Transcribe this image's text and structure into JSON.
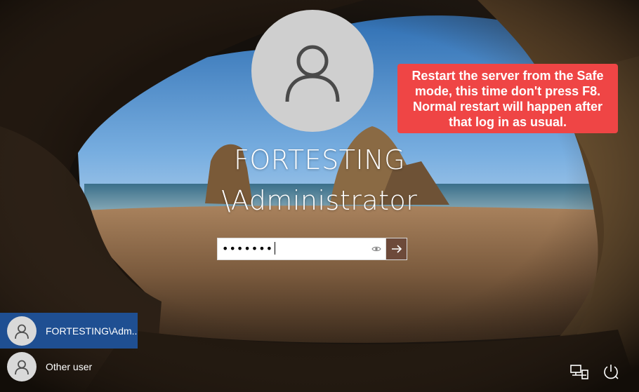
{
  "login": {
    "username_line1": "FORTESTING",
    "username_line2": "\\Administrator",
    "password_value": "•••••••",
    "caret_glyph": "I"
  },
  "callout": {
    "text": "Restart the server from the Safe mode, this time don't press F8. Normal restart will happen after that log in as usual."
  },
  "users": [
    {
      "label": "FORTESTING\\Adm...",
      "selected": true
    },
    {
      "label": "Other user",
      "selected": false
    }
  ],
  "icons": {
    "avatar": "user-silhouette-icon",
    "reveal": "eye-icon",
    "submit": "arrow-right-icon",
    "network": "network-icon",
    "power": "power-icon"
  },
  "colors": {
    "callout_bg": "#ef4545",
    "selected_user_bg": "#1f4f92",
    "submit_bg": "#6d4a3a"
  }
}
